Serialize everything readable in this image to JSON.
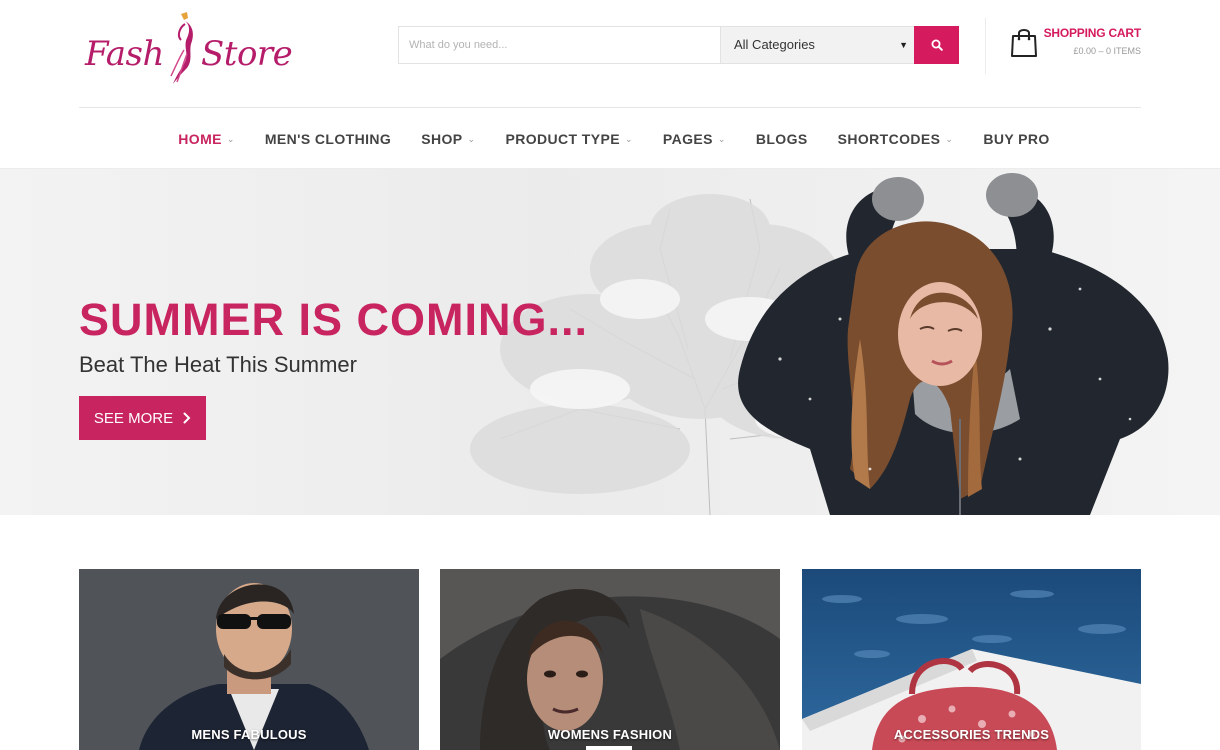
{
  "logo": {
    "text_left": "Fash",
    "text_right": "Store",
    "icon": "fashion-figure-icon",
    "brand_color": "#b51c6a"
  },
  "search": {
    "placeholder": "What do you need...",
    "value": "",
    "category_selected": "All Categories",
    "button_icon": "search-icon"
  },
  "cart": {
    "title": "SHOPPING CART",
    "summary": "£0.00 – 0 ITEMS",
    "icon": "shopping-bag-icon"
  },
  "nav": {
    "items": [
      {
        "label": "HOME",
        "active": true,
        "dropdown": true
      },
      {
        "label": "MEN'S CLOTHING",
        "active": false,
        "dropdown": false
      },
      {
        "label": "SHOP",
        "active": false,
        "dropdown": true
      },
      {
        "label": "PRODUCT TYPE",
        "active": false,
        "dropdown": true
      },
      {
        "label": "PAGES",
        "active": false,
        "dropdown": true
      },
      {
        "label": "BLOGS",
        "active": false,
        "dropdown": false
      },
      {
        "label": "SHORTCODES",
        "active": false,
        "dropdown": true
      },
      {
        "label": "BUY PRO",
        "active": false,
        "dropdown": false
      }
    ]
  },
  "hero": {
    "title": "SUMMER IS COMING...",
    "subtitle": "Beat The Heat This Summer",
    "button_label": "SEE MORE",
    "button_icon": "chevron-right-icon"
  },
  "categories": [
    {
      "label": "MENS FABULOUS"
    },
    {
      "label": "WOMENS FASHION"
    },
    {
      "label": "ACCESSORIES TRENDS"
    }
  ],
  "colors": {
    "accent": "#c8245f",
    "search_button": "#d51a5e",
    "text": "#333333"
  }
}
